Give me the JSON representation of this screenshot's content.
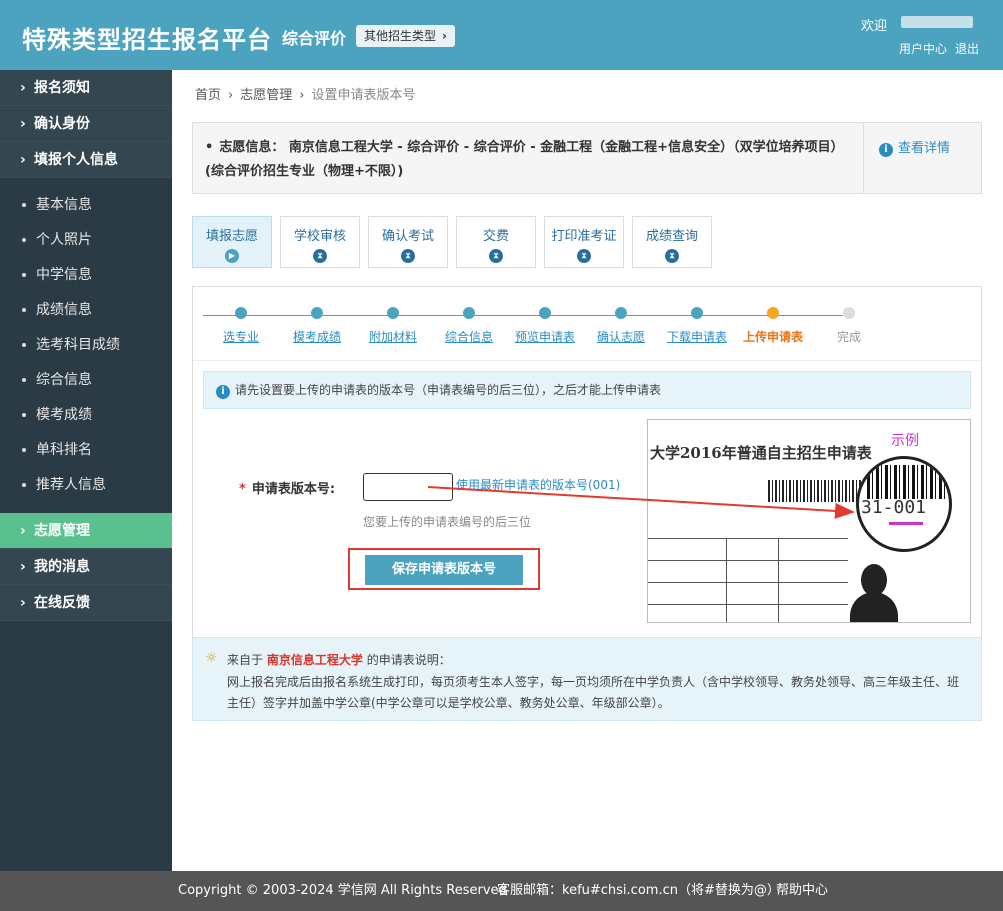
{
  "header": {
    "brand": "特殊类型招生报名平台",
    "sub": "综合评价",
    "type_button": "其他招生类型",
    "welcome": "欢迎",
    "user_center": "用户中心",
    "logout": "退出"
  },
  "sidebar": {
    "groups_top": [
      "报名须知",
      "确认身份",
      "填报个人信息"
    ],
    "sub_items": [
      "基本信息",
      "个人照片",
      "中学信息",
      "成绩信息",
      "选考科目成绩",
      "综合信息",
      "模考成绩",
      "单科排名",
      "推荐人信息"
    ],
    "active": "志愿管理",
    "groups_bottom": [
      "我的消息",
      "在线反馈"
    ]
  },
  "breadcrumb": [
    "首页",
    "志愿管理",
    "设置申请表版本号"
  ],
  "info": {
    "text": "志愿信息： 南京信息工程大学 - 综合评价 - 综合评价 - 金融工程（金融工程+信息安全）（双学位培养项目）(综合评价招生专业（物理+不限）)",
    "view_details": "查看详情"
  },
  "tabs": [
    "填报志愿",
    "学校审核",
    "确认考试",
    "交费",
    "打印准考证",
    "成绩查询"
  ],
  "steps": [
    "选专业",
    "模考成绩",
    "附加材料",
    "综合信息",
    "预览申请表",
    "确认志愿",
    "下载申请表",
    "上传申请表",
    "完成"
  ],
  "current_step": "上传申请表",
  "notice": "请先设置要上传的申请表的版本号（申请表编号的后三位），之后才能上传申请表",
  "form": {
    "label": "申请表版本号:",
    "required_mark": "*",
    "input_value": "",
    "use_latest": "使用最新申请表的版本号(001)",
    "hint": "您要上传的申请表编号的后三位",
    "save_button": "保存申请表版本号"
  },
  "sample": {
    "title": "大学2016年普通自主招生申请表",
    "tag": "示例",
    "code": "31-001"
  },
  "explain": {
    "prefix": "来自于",
    "school": "南京信息工程大学",
    "suffix": "的申请表说明：",
    "body": "网上报名完成后由报名系统生成打印，每页须考生本人签字，每一页均须所在中学负责人（含中学校领导、教务处领导、高三年级主任、班主任）签字并加盖中学公章(中学公章可以是学校公章、教务处公章、年级部公章）。"
  },
  "footer": {
    "copyright": "Copyright © 2003-2024 学信网 All Rights Reserved",
    "email": "客服邮箱：kefu#chsi.com.cn（将#替换为@）",
    "help": "帮助中心"
  },
  "colors": {
    "header": "#4ba3c0",
    "sidebar": "#2b3b45",
    "active": "#5ac18e",
    "highlight": "#e23a2e"
  }
}
